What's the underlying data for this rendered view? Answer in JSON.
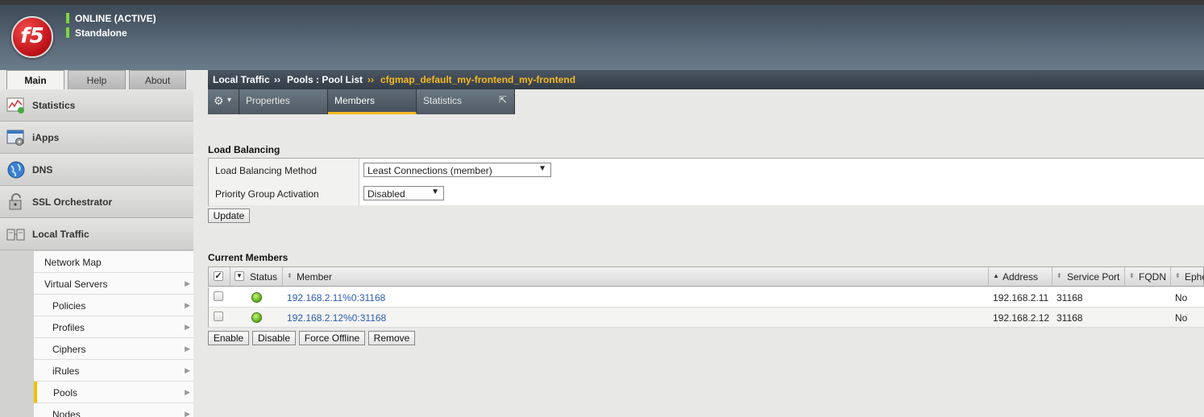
{
  "header": {
    "logo_text": "f5",
    "status_line1": "ONLINE (ACTIVE)",
    "status_line2": "Standalone"
  },
  "top_tabs": [
    {
      "label": "Main",
      "active": true
    },
    {
      "label": "Help",
      "active": false
    },
    {
      "label": "About",
      "active": false
    }
  ],
  "sidebar": {
    "items": [
      {
        "label": "Statistics",
        "icon": "statistics-chart-icon"
      },
      {
        "label": "iApps",
        "icon": "iapps-gear-icon"
      },
      {
        "label": "DNS",
        "icon": "dns-globe-icon"
      },
      {
        "label": "SSL Orchestrator",
        "icon": "ssl-lock-icon"
      },
      {
        "label": "Local Traffic",
        "icon": "local-traffic-servers-icon"
      }
    ],
    "sub_items": [
      {
        "label": "Network Map",
        "arrow": ""
      },
      {
        "label": "Virtual Servers",
        "arrow": "▶"
      },
      {
        "label": "Policies",
        "arrow": "▶"
      },
      {
        "label": "Profiles",
        "arrow": "▶"
      },
      {
        "label": "Ciphers",
        "arrow": "▶"
      },
      {
        "label": "iRules",
        "arrow": "▶"
      },
      {
        "label": "Pools",
        "arrow": "▶",
        "active": true
      },
      {
        "label": "Nodes",
        "arrow": "▶"
      }
    ]
  },
  "breadcrumb": {
    "part1": "Local Traffic",
    "sep1": "››",
    "part2": "Pools : Pool List",
    "sep2": "››",
    "current": "cfgmap_default_my-frontend_my-frontend"
  },
  "subtabs": {
    "gear": "⚙",
    "gear_caret": "▾",
    "items": [
      {
        "label": "Properties",
        "active": false
      },
      {
        "label": "Members",
        "active": true
      },
      {
        "label": "Statistics",
        "active": false,
        "icon": "⇱"
      }
    ]
  },
  "load_balancing": {
    "title": "Load Balancing",
    "rows": [
      {
        "key": "Load Balancing Method",
        "value": "Least Connections (member)"
      },
      {
        "key": "Priority Group Activation",
        "value": "Disabled"
      }
    ],
    "dropdown_arrow": "▼",
    "update_button": "Update"
  },
  "members": {
    "title": "Current Members",
    "columns": {
      "status": "Status",
      "member": "Member",
      "address": "Address",
      "service_port": "Service Port",
      "fqdn": "FQDN",
      "ephemeral": "Ephe"
    },
    "sort_up": "▲",
    "sort_both": "⬍",
    "rows": [
      {
        "member": "192.168.2.11%0:31168",
        "address": "192.168.2.11",
        "port": "31168",
        "fqdn": "",
        "ephemeral": "No"
      },
      {
        "member": "192.168.2.12%0:31168",
        "address": "192.168.2.12",
        "port": "31168",
        "fqdn": "",
        "ephemeral": "No"
      }
    ],
    "buttons": {
      "enable": "Enable",
      "disable": "Disable",
      "force_offline": "Force Offline",
      "remove": "Remove"
    }
  }
}
